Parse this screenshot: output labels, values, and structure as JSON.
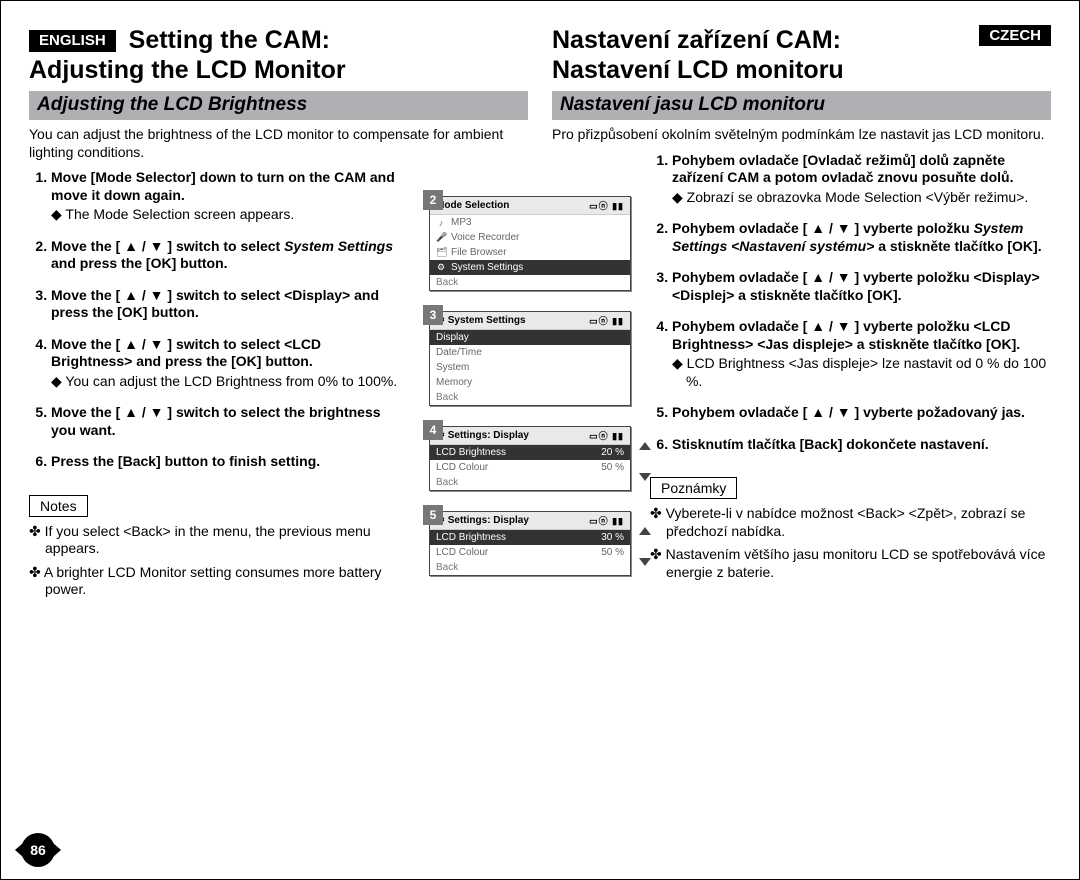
{
  "page_number": "86",
  "left": {
    "lang_badge": "ENGLISH",
    "title_line1": "Setting the CAM:",
    "title_line2": "Adjusting the LCD Monitor",
    "section": "Adjusting the LCD Brightness",
    "intro": "You can adjust the brightness of the LCD monitor to compensate for ambient lighting conditions.",
    "steps": {
      "s1": "Move [Mode Selector] down to turn on the CAM and move it down again.",
      "s1_sub": "The Mode Selection screen appears.",
      "s2a": "Move the [ ▲ / ▼ ] switch to select ",
      "s2_em": "System Settings",
      "s2b": " and press the [OK] button.",
      "s3": "Move the [ ▲ / ▼ ] switch to select <Display> and press the [OK] button.",
      "s4": "Move the [ ▲ / ▼ ] switch to select <LCD Brightness> and press the [OK] button.",
      "s4_sub": "You can adjust the LCD Brightness from 0% to 100%.",
      "s5": "Move the [ ▲ / ▼ ] switch to select the brightness you want.",
      "s6": "Press the [Back] button to finish setting."
    },
    "notes_label": "Notes",
    "notes": {
      "n1": "If you select <Back> in the menu, the previous menu appears.",
      "n2": "A brighter LCD Monitor setting consumes more battery power."
    }
  },
  "right": {
    "lang_badge": "CZECH",
    "title_line1": "Nastavení zařízení CAM:",
    "title_line2": "Nastavení LCD monitoru",
    "section": "Nastavení jasu LCD monitoru",
    "intro": "Pro přizpůsobení okolním světelným podmínkám lze nastavit jas LCD monitoru.",
    "steps": {
      "s1": "Pohybem ovladače [Ovladač režimů] dolů zapněte zařízení CAM a potom ovladač znovu posuňte dolů.",
      "s1_sub": "Zobrazí se obrazovka Mode Selection <Výběr režimu>.",
      "s2a": "Pohybem ovladače [ ▲ / ▼ ] vyberte položku ",
      "s2_em": "System Settings <Nastavení systému>",
      "s2b": " a stiskněte tlačítko [OK].",
      "s3": "Pohybem ovladače [ ▲ / ▼ ] vyberte položku <Display> <Displej> a stiskněte tlačítko [OK].",
      "s4": "Pohybem ovladače [ ▲ / ▼ ] vyberte položku <LCD Brightness> <Jas displeje> a stiskněte tlačítko [OK].",
      "s4_sub": "LCD Brightness <Jas displeje> lze nastavit od 0 % do 100 %.",
      "s5": "Pohybem ovladače [ ▲ / ▼ ] vyberte požadovaný jas.",
      "s6": "Stisknutím tlačítka [Back] dokončete nastavení."
    },
    "notes_label": "Poznámky",
    "notes": {
      "n1": "Vyberete-li v nabídce možnost <Back> <Zpět>, zobrazí se předchozí nabídka.",
      "n2": "Nastavením většího jasu monitoru LCD se spotřebovává více energie z baterie."
    }
  },
  "screens": {
    "s2": {
      "num": "2",
      "title": "Mode Selection",
      "rows": [
        "MP3",
        "Voice Recorder",
        "File Browser",
        "System Settings",
        "Back"
      ],
      "icons": [
        "♪",
        "🎤",
        "🗂",
        "⚙",
        ""
      ],
      "selected": 3
    },
    "s3": {
      "num": "3",
      "title": "System Settings",
      "rows": [
        "Display",
        "Date/Time",
        "System",
        "Memory",
        "Back"
      ],
      "selected": 0
    },
    "s4": {
      "num": "4",
      "title": "Settings: Display",
      "rows": [
        {
          "label": "LCD Brightness",
          "val": "20 %"
        },
        {
          "label": "LCD Colour",
          "val": "50 %"
        },
        {
          "label": "Back",
          "val": ""
        }
      ],
      "selected": 0
    },
    "s5": {
      "num": "5",
      "title": "Settings: Display",
      "rows": [
        {
          "label": "LCD Brightness",
          "val": "30 %"
        },
        {
          "label": "LCD Colour",
          "val": "50 %"
        },
        {
          "label": "Back",
          "val": ""
        }
      ],
      "selected": 0
    },
    "status_icons": "▭ⓝ ▮▮"
  }
}
